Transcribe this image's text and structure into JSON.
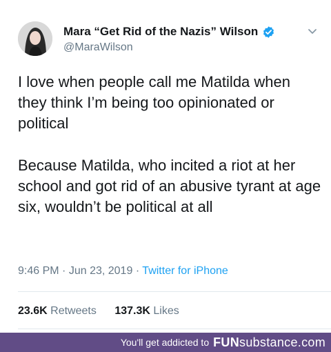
{
  "tweet": {
    "display_name": "Mara “Get Rid of the Nazis” Wilson",
    "handle": "@MaraWilson",
    "paragraphs": [
      "I love when people call me Matilda when they think I’m being too opinionated or political",
      "Because Matilda, who incited a riot at her school and got rid of an abusive tyrant at age six, wouldn’t be political at all"
    ],
    "time": "9:46 PM",
    "date": "Jun 23, 2019",
    "source": "Twitter for iPhone",
    "retweets_count": "23.6K",
    "retweets_label": "Retweets",
    "likes_count": "137.3K",
    "likes_label": "Likes",
    "icons": [
      "avatar",
      "verified-badge-icon",
      "chevron-down-icon"
    ]
  },
  "footer": {
    "tagline": "You'll get addicted to",
    "logo_main": "FUN",
    "logo_sub": "substance",
    "logo_suffix": ".com"
  },
  "colors": {
    "text": "#14171a",
    "secondary": "#657786",
    "link": "#1da1f2",
    "verified": "#1da1f2",
    "footer_bg": "#614c86"
  }
}
